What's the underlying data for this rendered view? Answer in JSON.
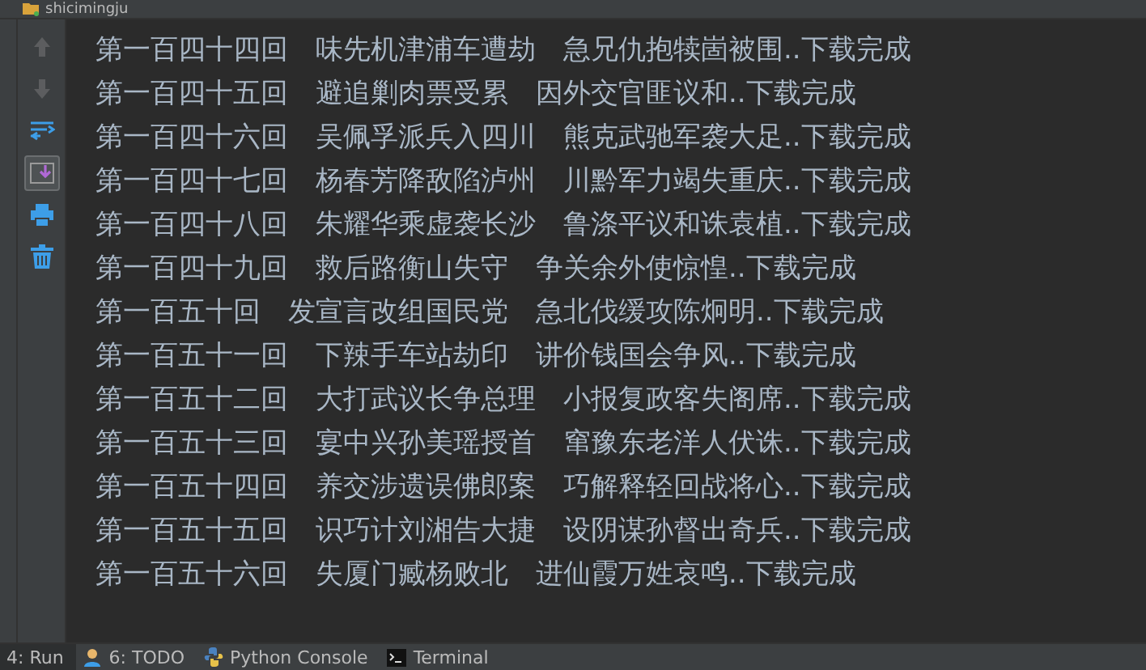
{
  "run_tab": {
    "title": "shicimingju"
  },
  "toolbar": [
    {
      "kind": "up",
      "disabled": true,
      "selected": false
    },
    {
      "kind": "down",
      "disabled": true,
      "selected": false
    },
    {
      "kind": "wrap",
      "disabled": false,
      "selected": false
    },
    {
      "kind": "scroll",
      "disabled": false,
      "selected": true
    },
    {
      "kind": "print",
      "disabled": false,
      "selected": false
    },
    {
      "kind": "trash",
      "disabled": false,
      "selected": false
    }
  ],
  "console_lines": [
    "第一百四十四回　味先机津浦车遭劫　急兄仇抱犊崮被围..下载完成",
    "第一百四十五回　避追剿肉票受累　因外交官匪议和..下载完成",
    "第一百四十六回　吴佩孚派兵入四川　熊克武驰军袭大足..下载完成",
    "第一百四十七回　杨春芳降敌陷泸州　川黔军力竭失重庆..下载完成",
    "第一百四十八回　朱耀华乘虚袭长沙　鲁涤平议和诛袁植..下载完成",
    "第一百四十九回　救后路衡山失守　争关余外使惊惶..下载完成",
    "第一百五十回　发宣言改组国民党　急北伐缓攻陈炯明..下载完成",
    "第一百五十一回　下辣手车站劫印　讲价钱国会争风..下载完成",
    "第一百五十二回　大打武议长争总理　小报复政客失阁席..下载完成",
    "第一百五十三回　宴中兴孙美瑶授首　窜豫东老洋人伏诛..下载完成",
    "第一百五十四回　养交涉遗误佛郎案　巧解释轻回战将心..下载完成",
    "第一百五十五回　识巧计刘湘告大捷　设阴谋孙督出奇兵..下载完成",
    "第一百五十六回　失厦门臧杨败北　进仙霞万姓哀鸣..下载完成"
  ],
  "bottom_tabs": [
    {
      "kind": "run",
      "label": "4: Run",
      "selected": true
    },
    {
      "kind": "todo",
      "label": "6: TODO",
      "selected": false
    },
    {
      "kind": "python",
      "label": "Python Console",
      "selected": false
    },
    {
      "kind": "terminal",
      "label": "Terminal",
      "selected": false
    }
  ]
}
